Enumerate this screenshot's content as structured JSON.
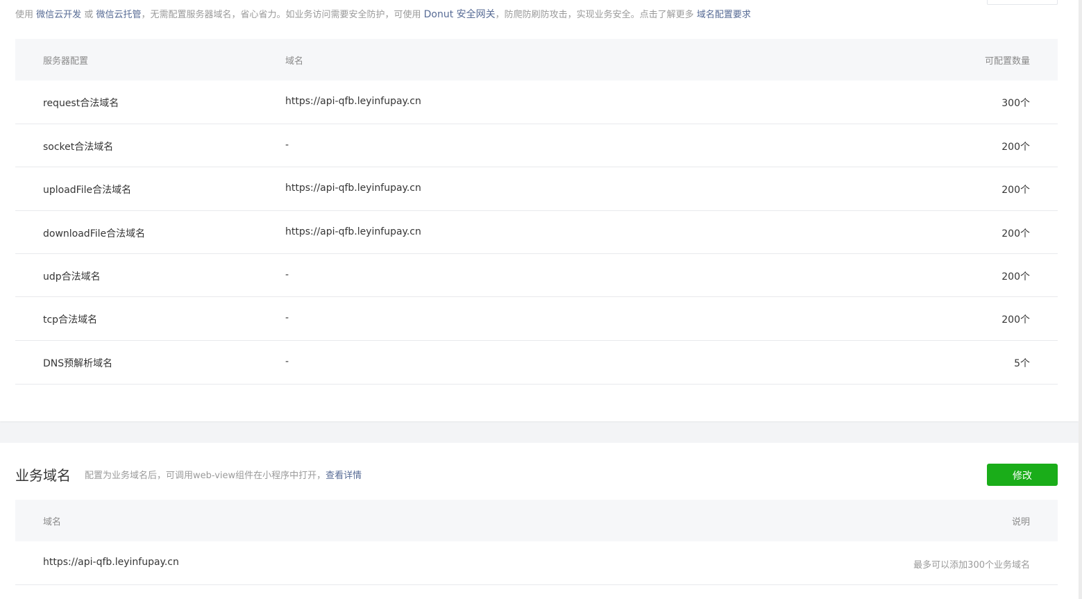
{
  "server_section": {
    "notice": {
      "prefix": "使用",
      "link_cloud_dev": "微信云开发",
      "or": "或",
      "link_cloud_host": "微信云托管",
      "mid": "，无需配置服务器域名，省心省力。如业务访问需要安全防护，可使用",
      "link_donut": "Donut 安全网关",
      "suffix": "，防爬防刷防攻击，实现业务安全。点击了解更多",
      "link_requirements": "域名配置要求"
    },
    "table": {
      "headers": {
        "config": "服务器配置",
        "domain": "域名",
        "count": "可配置数量"
      },
      "rows": [
        {
          "config": "request合法域名",
          "domain": "https://api-qfb.leyinfupay.cn",
          "count": "300个"
        },
        {
          "config": "socket合法域名",
          "domain": "-",
          "count": "200个"
        },
        {
          "config": "uploadFile合法域名",
          "domain": "https://api-qfb.leyinfupay.cn",
          "count": "200个"
        },
        {
          "config": "downloadFile合法域名",
          "domain": "https://api-qfb.leyinfupay.cn",
          "count": "200个"
        },
        {
          "config": "udp合法域名",
          "domain": "-",
          "count": "200个"
        },
        {
          "config": "tcp合法域名",
          "domain": "-",
          "count": "200个"
        },
        {
          "config": "DNS预解析域名",
          "domain": "-",
          "count": "5个"
        }
      ]
    }
  },
  "business_section": {
    "title": "业务域名",
    "description": "配置为业务域名后，可调用web-view组件在小程序中打开，",
    "details_link": "查看详情",
    "modify_button": "修改",
    "table": {
      "headers": {
        "domain": "域名",
        "note": "说明"
      },
      "rows": [
        {
          "domain": "https://api-qfb.leyinfupay.cn",
          "note": "最多可以添加300个业务域名"
        }
      ]
    }
  },
  "colors": {
    "primary_green": "#1aad19",
    "link_blue": "#576b95",
    "header_bg": "#f6f7f9",
    "page_bg": "#f3f4f6"
  }
}
